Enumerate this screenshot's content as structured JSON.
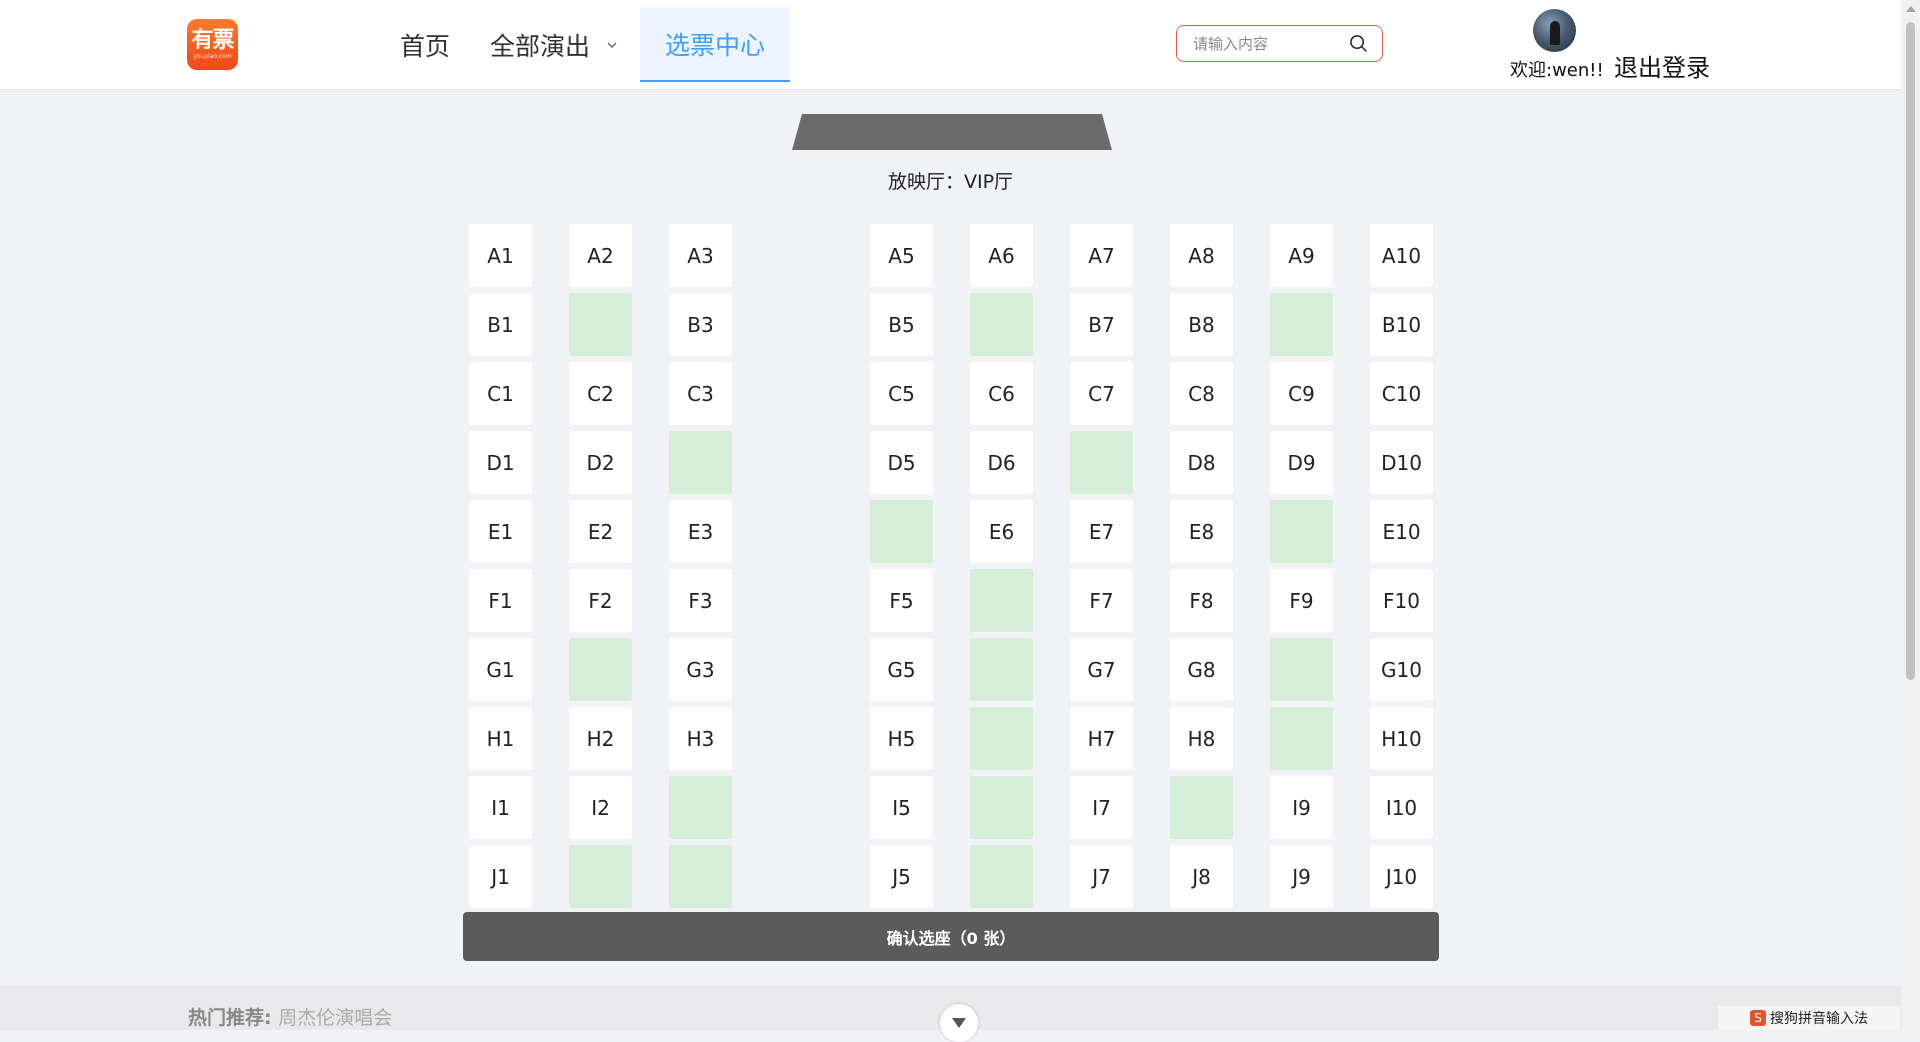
{
  "header": {
    "logo": {
      "text": "有票",
      "subtext": "youpiao.com"
    },
    "nav": [
      {
        "label": "首页",
        "active": false
      },
      {
        "label": "全部演出",
        "active": false,
        "has_dropdown": true
      },
      {
        "label": "选票中心",
        "active": true
      }
    ],
    "search": {
      "placeholder": "请输入内容",
      "value": ""
    },
    "welcome": "欢迎:wen!!",
    "logout": "退出登录"
  },
  "hall": {
    "text": "放映厅：VIP厅"
  },
  "seat_map": {
    "rows": [
      "A",
      "B",
      "C",
      "D",
      "E",
      "F",
      "G",
      "H",
      "I",
      "J"
    ],
    "columns": [
      1,
      2,
      3,
      5,
      6,
      7,
      8,
      9,
      10
    ],
    "sold": [
      "B2",
      "B6",
      "B9",
      "D3",
      "D7",
      "E5",
      "E9",
      "F6",
      "G2",
      "G6",
      "G9",
      "H6",
      "H9",
      "I3",
      "I6",
      "I8",
      "J2",
      "J3",
      "J6"
    ],
    "colors": {
      "available": "#ffffff",
      "sold": "#d4eed8"
    }
  },
  "confirm": {
    "label": "确认选座（0 张）"
  },
  "footer": {
    "hot_label": "热门推荐:",
    "hot_link": "周杰伦演唱会",
    "ime": "搜狗拼音输入法",
    "ime_icon": "S"
  }
}
